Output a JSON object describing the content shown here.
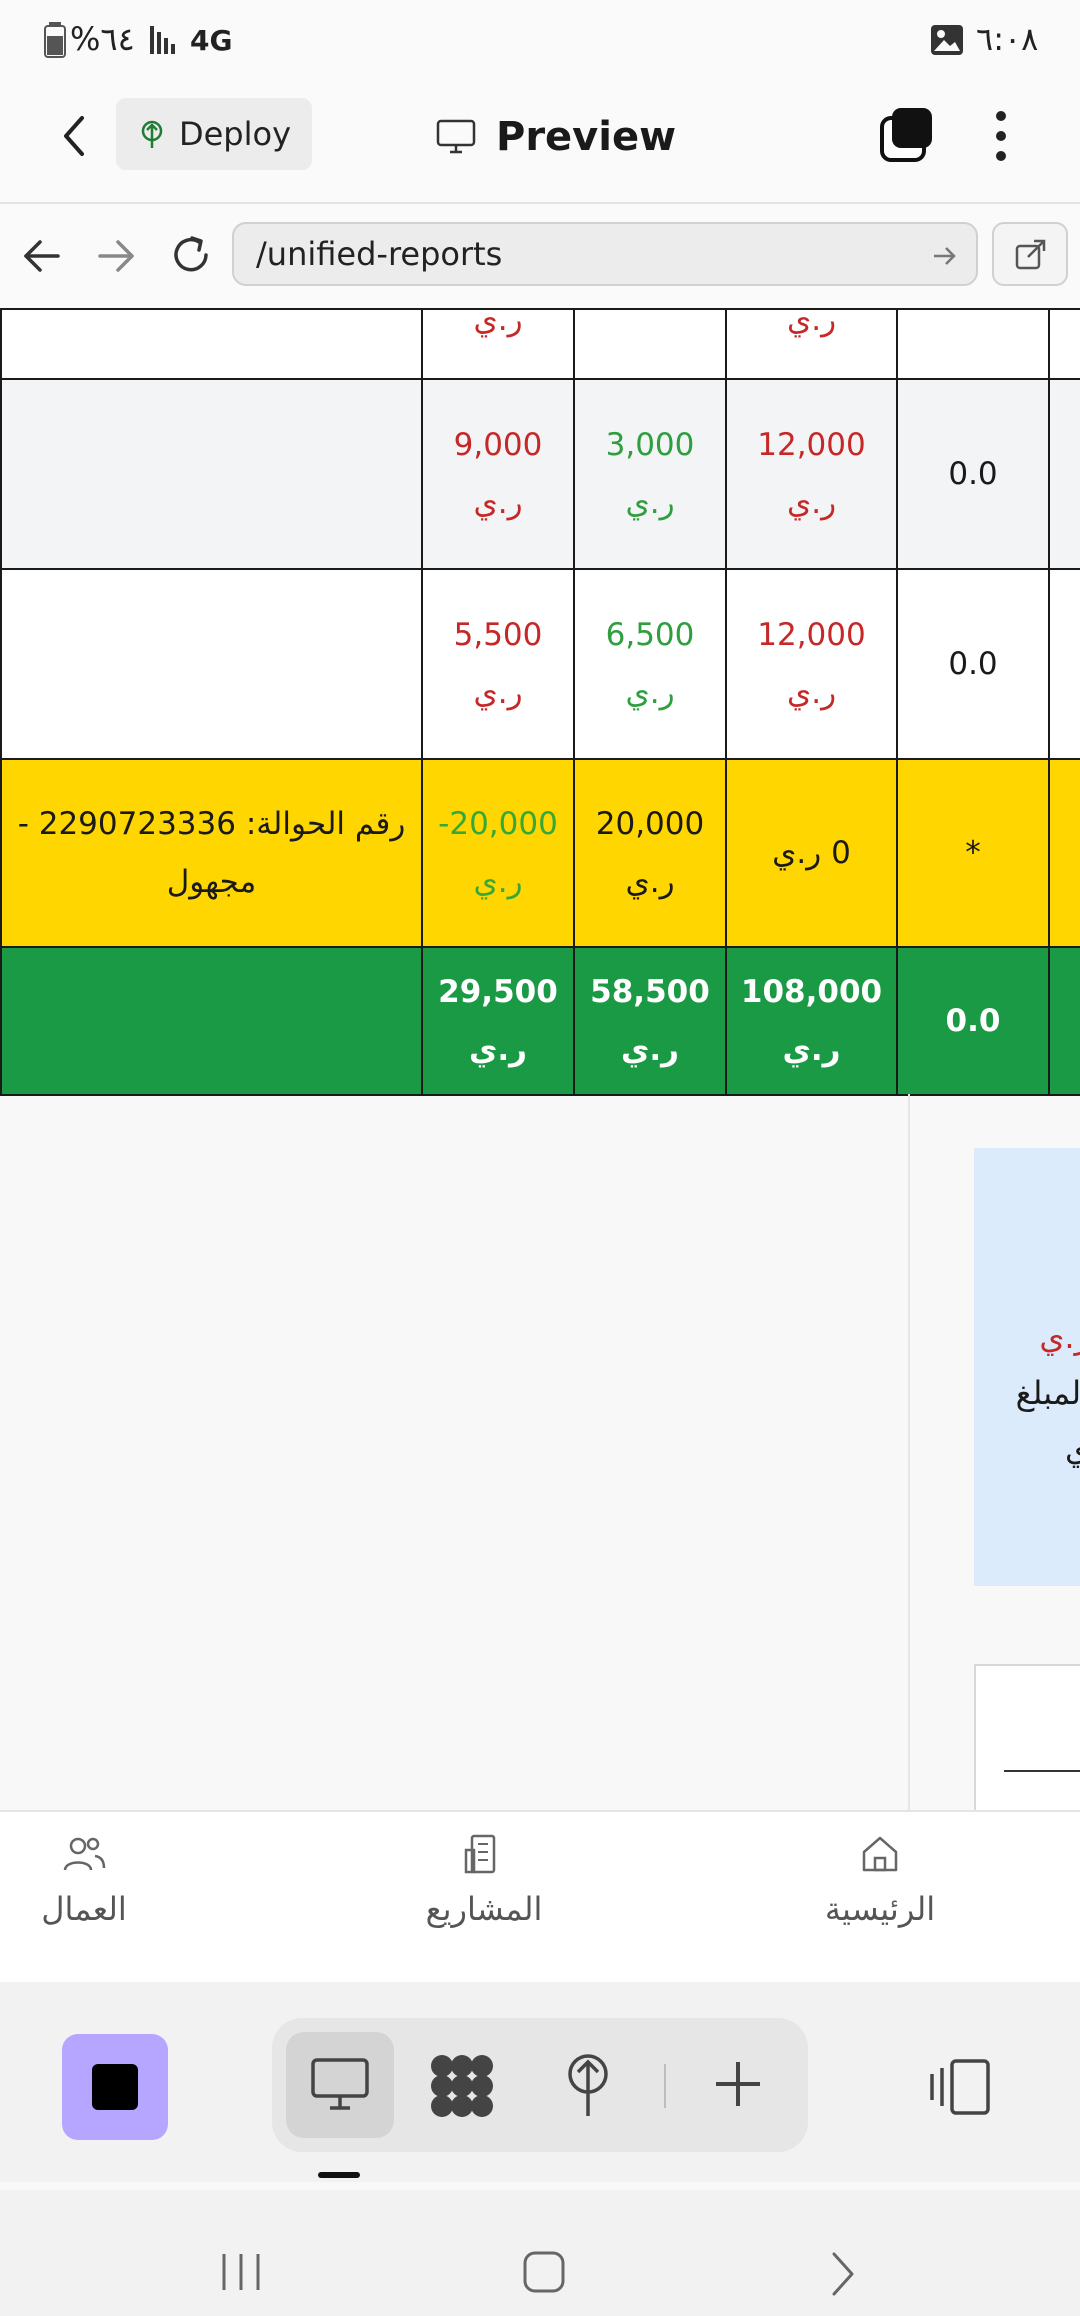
{
  "status_bar": {
    "time": "٦:٠٨",
    "battery": "%٦٤",
    "network": "4G"
  },
  "header": {
    "deploy_label": "Deploy",
    "preview_label": "Preview"
  },
  "url_bar": {
    "path": "/unified-reports"
  },
  "table": {
    "currency": "ر.ي",
    "rows": [
      {
        "style": "white",
        "c1": "",
        "c1_color": "red",
        "c2": "",
        "c2_color": "green",
        "c3": "",
        "c3_color": "red",
        "c4": ""
      },
      {
        "style": "alt",
        "c1": "9,000",
        "c1_color": "red",
        "c2": "3,000",
        "c2_color": "green",
        "c3": "12,000",
        "c3_color": "red",
        "c4": "0.0"
      },
      {
        "style": "white",
        "c1": "5,500",
        "c1_color": "red",
        "c2": "6,500",
        "c2_color": "green",
        "c3": "12,000",
        "c3_color": "red",
        "c4": "0.0"
      }
    ],
    "highlight_row": {
      "note_line1": "رقم الحوالة: 2290723336 -",
      "note_line2": "مجهول",
      "c1": "-20,000",
      "c2": "20,000",
      "c3": "0 ر.ي",
      "c4": "*"
    },
    "totals_row": {
      "c1": "29,500",
      "c2": "58,500",
      "c3": "108,000",
      "c4": "0.0"
    }
  },
  "side_panel": {
    "line1": "ر.ي",
    "line2": "المبلغ",
    "line3": "ي"
  },
  "bottom_nav": [
    {
      "label": "العمال",
      "icon": "users-icon"
    },
    {
      "label": "المشاريع",
      "icon": "building-icon"
    },
    {
      "label": "الرئيسية",
      "icon": "home-icon"
    }
  ],
  "colors": {
    "red": "#c62828",
    "green": "#2e9e3e",
    "yellow": "#ffd600",
    "total_green": "#1a9a45",
    "accent_purple": "#b7a6ff"
  }
}
